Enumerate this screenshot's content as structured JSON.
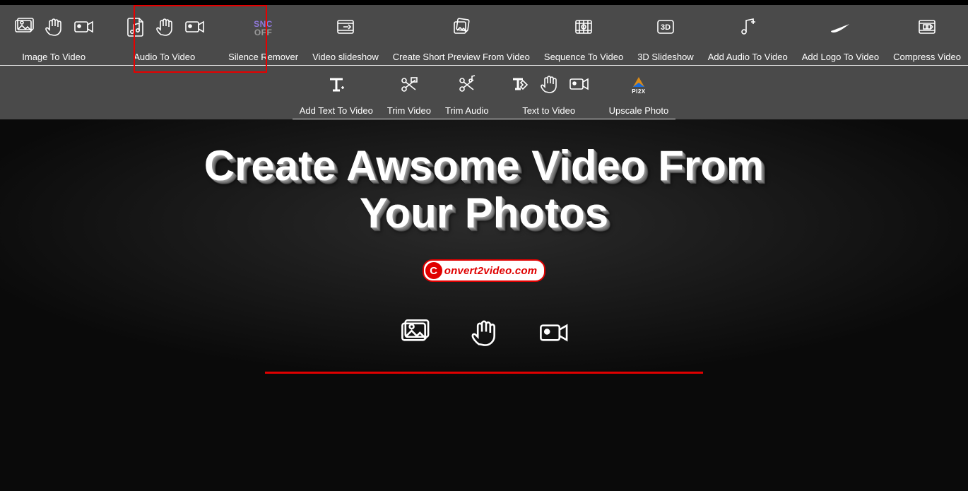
{
  "toolbar": {
    "row1": [
      {
        "label": "Image To Video"
      },
      {
        "label": "Audio To Video"
      },
      {
        "label": "Silence Remover"
      },
      {
        "label": "Video slideshow"
      },
      {
        "label": "Create Short Preview From Video"
      },
      {
        "label": "Sequence To Video"
      },
      {
        "label": "3D Slideshow"
      },
      {
        "label": "Add Audio To Video"
      },
      {
        "label": "Add Logo To Video"
      },
      {
        "label": "Compress Video"
      }
    ],
    "row2": [
      {
        "label": "Add Text To Video"
      },
      {
        "label": "Trim Video"
      },
      {
        "label": "Trim Audio"
      },
      {
        "label": "Text to Video"
      },
      {
        "label": "Upscale Photo"
      }
    ],
    "snc": {
      "line1": "SNC",
      "line2": "OFF"
    },
    "pi2x": "PI2X"
  },
  "hero": {
    "title_line1": "Create Awsome Video From",
    "title_line2": "Your Photos",
    "brand_c": "C",
    "brand_text": "onvert2video.com"
  },
  "highlight": {
    "target": "Audio To Video"
  },
  "colors": {
    "accent_red": "#e00000",
    "toolbar_bg": "#4a4a4a"
  }
}
